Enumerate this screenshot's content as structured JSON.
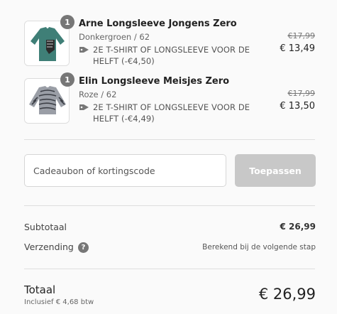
{
  "cart": {
    "items": [
      {
        "quantity": "1",
        "name": "Arne Longsleeve Jongens Zero",
        "variant": "Donkergroen / 62",
        "discount_line1": "2E T-SHIRT OF LONGSLEEVE VOOR DE",
        "discount_line2": "HELFT (-€4,50)",
        "old_price": "€17,99",
        "new_price": "€ 13,49",
        "thumb_color": "#3f7f77",
        "thumb_icon": "longsleeve-icon"
      },
      {
        "quantity": "1",
        "name": "Elin Longsleeve Meisjes Zero",
        "variant": "Roze / 62",
        "discount_line1": "2E T-SHIRT OF LONGSLEEVE VOOR DE",
        "discount_line2": "HELFT (-€4,49)",
        "old_price": "€17,99",
        "new_price": "€ 13,50",
        "thumb_color": "#8c8f96",
        "thumb_icon": "zebra-longsleeve-icon"
      }
    ]
  },
  "coupon": {
    "placeholder": "Cadeaubon of kortingscode",
    "apply_label": "Toepassen"
  },
  "summary": {
    "subtotal_label": "Subtotaal",
    "subtotal_value": "€ 26,99",
    "shipping_label": "Verzending",
    "shipping_value": "Berekend bij de volgende stap",
    "help_icon": "?",
    "total_label": "Totaal",
    "tax_note": "Inclusief € 4,68 btw",
    "total_value": "€ 26,99"
  }
}
